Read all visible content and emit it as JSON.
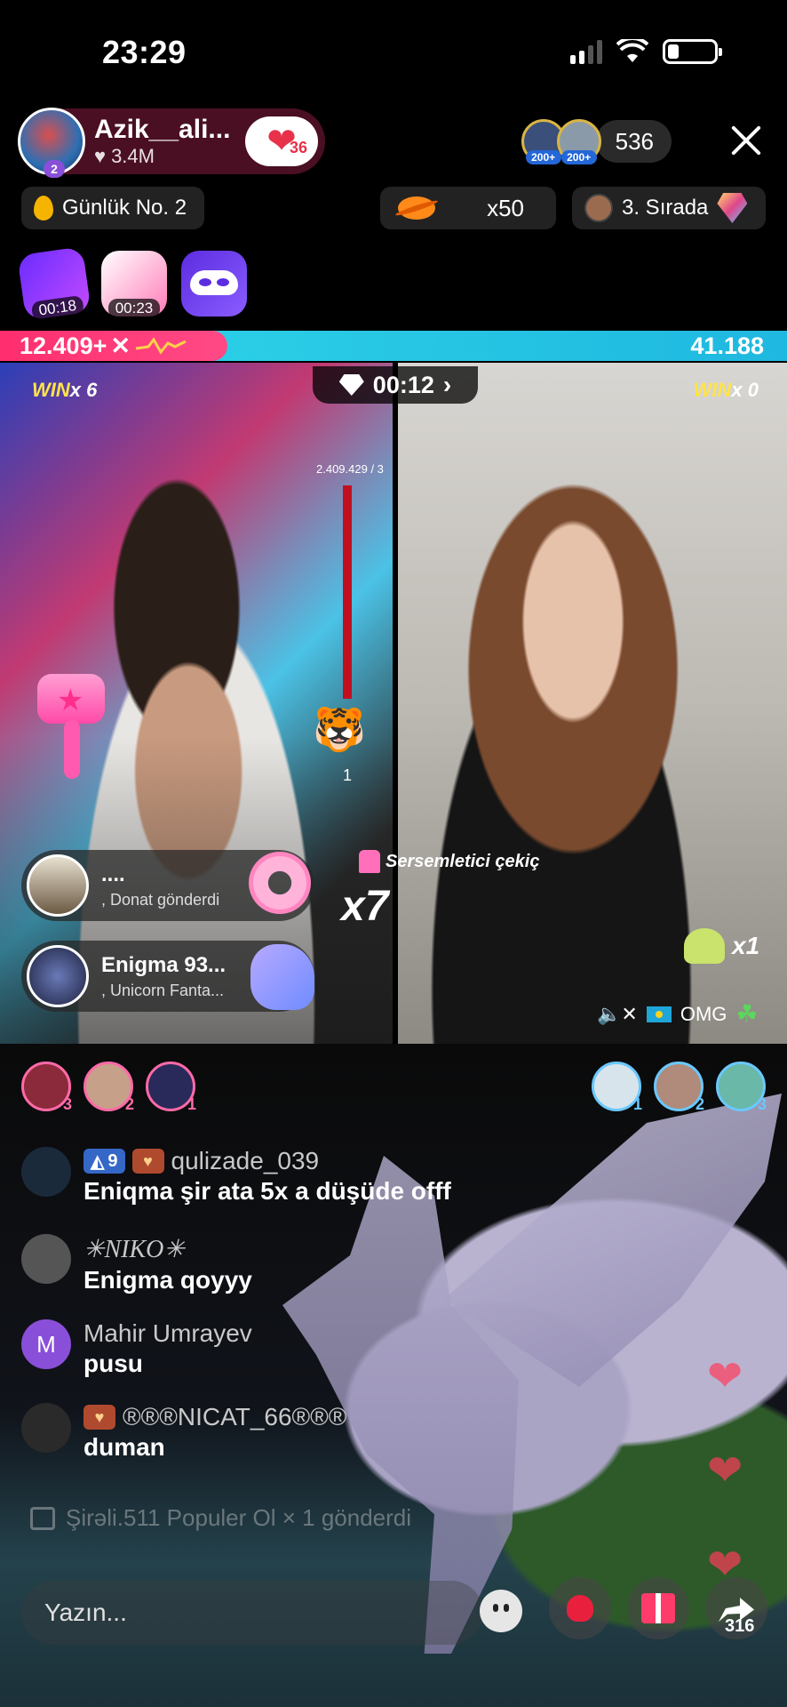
{
  "status_bar": {
    "time": "23:29"
  },
  "host": {
    "name": "Azik__ali...",
    "likes": "3.4M",
    "follow_badge": "36",
    "level_badge": "2"
  },
  "viewers": {
    "avatar_levels": [
      "200+",
      "200+"
    ],
    "count": "536"
  },
  "chips": {
    "daily_rank": "Günlük No. 2",
    "multiplier": "x50",
    "hourly_rank": "3. Sırada"
  },
  "boosts": [
    {
      "time": "00:18"
    },
    {
      "time": "00:23"
    }
  ],
  "battle": {
    "left_score": "12.409+",
    "left_score_suffix": "✕",
    "right_score": "41.188",
    "timer": "00:12",
    "left_win_count": "6",
    "right_win_count": "0",
    "win_label": "WIN",
    "win_mult_prefix": "x ",
    "meter_value": "2.409.429 / 3",
    "tiger_count": "1"
  },
  "gift_feed": [
    {
      "user": "....",
      "message": ", Donat  gönderdi"
    },
    {
      "user": "Enigma 93...",
      "message": ", Unicorn Fanta..."
    }
  ],
  "combo": {
    "prefix": "x",
    "count": "7"
  },
  "gift_label": "Sersemletici çekiç",
  "right_gift": {
    "count": "x1"
  },
  "right_tag": {
    "name": "OMG"
  },
  "top_gifters_left": [
    "3",
    "2",
    "1"
  ],
  "top_gifters_right": [
    "1",
    "2",
    "3"
  ],
  "comments": [
    {
      "level": "9",
      "user": "qulizade_039",
      "message": "Eniqma şir ata 5x a düşüde offf"
    },
    {
      "user": "✳NIKO✳",
      "message": "Enigma qoyyy"
    },
    {
      "avatar_letter": "M",
      "user": "Mahir Umrayev",
      "message": "pusu"
    },
    {
      "user": "®®®NICAT_66®®®",
      "message": "duman"
    }
  ],
  "gift_log": "Şirəli.511 Populer Ol × 1 gönderdi",
  "input": {
    "placeholder": "Yazın..."
  },
  "share_count": "316",
  "colors": {
    "accent_pink": "#ff2e6e",
    "accent_cyan": "#2fd6e8",
    "win_yellow": "#ffe34a"
  }
}
